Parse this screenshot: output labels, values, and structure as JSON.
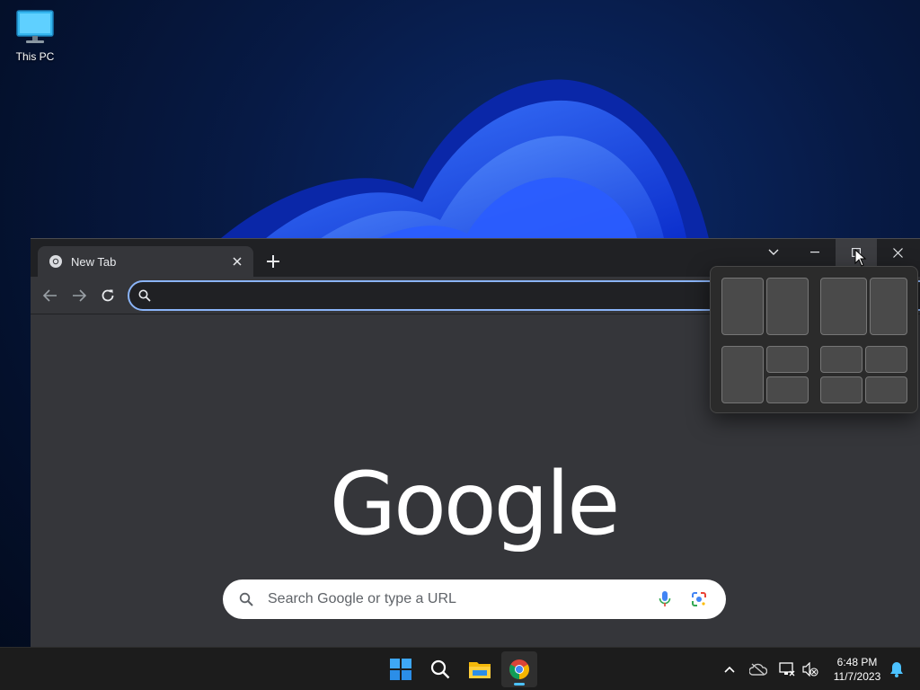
{
  "desktop": {
    "icons": [
      {
        "label": "This PC",
        "icon": "monitor-icon"
      }
    ]
  },
  "browser": {
    "tab": {
      "title": "New Tab",
      "icon": "chrome-icon"
    },
    "window_controls": [
      "tab-search-icon",
      "minimize-icon",
      "maximize-icon",
      "close-icon"
    ],
    "toolbar": {
      "back_icon": "arrow-left-icon",
      "forward_icon": "arrow-right-icon",
      "reload_icon": "reload-icon",
      "omnibox_value": ""
    },
    "ntp": {
      "logo": "Google",
      "search_placeholder": "Search Google or type a URL",
      "voice_icon": "microphone-icon",
      "lens_icon": "lens-icon"
    }
  },
  "snap_layouts": {
    "layouts": [
      "half-half",
      "two-thirds-one-third",
      "half-quarters",
      "quarters"
    ]
  },
  "taskbar": {
    "apps": [
      "windows-start-icon",
      "search-icon",
      "file-explorer-icon",
      "chrome-icon"
    ],
    "active_app": "chrome",
    "tray": [
      "chevron-up-icon",
      "onedrive-icon",
      "network-icon",
      "volume-muted-icon"
    ],
    "time": "6:48 PM",
    "date": "11/7/2023"
  },
  "colors": {
    "accent": "#8ab4f8",
    "window_bg": "#35363a",
    "titlebar_bg": "#202124",
    "taskbar_bg": "#1c1c1c",
    "active_indicator": "#4cc2ff"
  }
}
